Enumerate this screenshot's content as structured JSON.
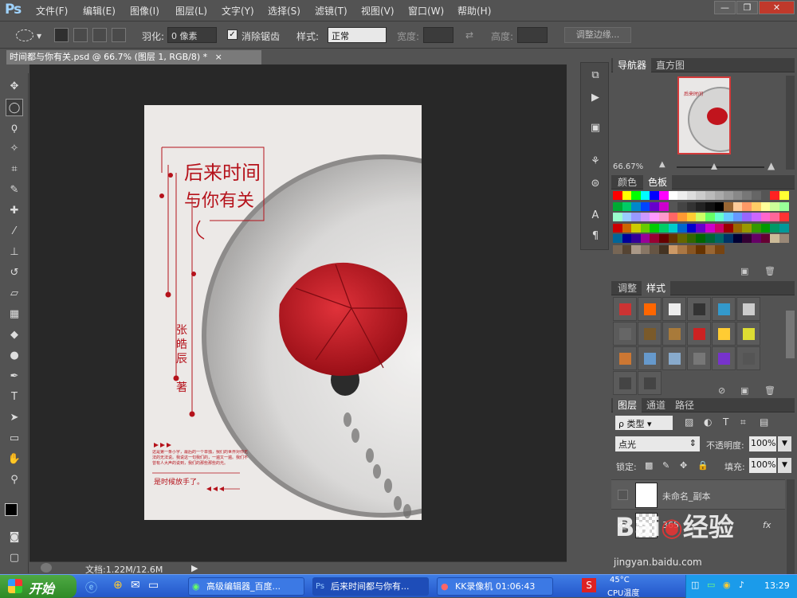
{
  "app": {
    "logo": "Ps"
  },
  "menu": [
    "文件(F)",
    "编辑(E)",
    "图像(I)",
    "图层(L)",
    "文字(Y)",
    "选择(S)",
    "滤镜(T)",
    "视图(V)",
    "窗口(W)",
    "帮助(H)"
  ],
  "window_controls": {
    "minimize": "—",
    "restore": "❐",
    "close": "✕"
  },
  "options": {
    "feather_label": "羽化:",
    "feather_value": "0 像素",
    "antialias_label": "消除锯齿",
    "style_label": "样式:",
    "style_value": "正常",
    "width_label": "宽度:",
    "height_label": "高度:",
    "refine_edge": "调整边缘..."
  },
  "document": {
    "tab_title": "时间都与你有关.psd @ 66.7% (图层 1, RGB/8) *",
    "tab_close": "×"
  },
  "poster": {
    "title_line1": "后来时间",
    "title_line2": "与你有关",
    "author": "张皓辰",
    "author_suffix": "著",
    "body_text": "这是第一条小字，最后的一个单独，我们的世界对你无法的无法说。我说这一句我们的，一遍又一遍。我们不曾有人大声的说到，我们的那些那些的光。",
    "closing_line": "是时候放手了。"
  },
  "status": {
    "doc_size": "文档:1.22M/12.6M"
  },
  "navigator": {
    "tab_active": "导航器",
    "tab_2": "直方图",
    "zoom": "66.67%"
  },
  "color_panel": {
    "tab_1": "颜色",
    "tab_active": "色板"
  },
  "styles_panel": {
    "tab_1": "调整",
    "tab_active": "样式"
  },
  "layers_panel": {
    "tab_active": "图层",
    "tab_2": "通道",
    "tab_3": "路径",
    "filter_kind": "ρ 类型",
    "blend_mode": "点光",
    "opacity_label": "不透明度:",
    "opacity_value": "100%",
    "lock_label": "锁定:",
    "fill_label": "填充:",
    "fill_value": "100%",
    "layers": [
      {
        "name": "未命名_副本"
      },
      {
        "name": "365"
      }
    ],
    "fx": "fx"
  },
  "taskbar": {
    "start": "开始",
    "tasks": [
      "高级编辑器_百度...",
      "后来时间都与你有...",
      "KK录像机 01:06:43"
    ],
    "cpu_temp": "45°C",
    "cpu_label": "CPU温度",
    "time": "13:29"
  },
  "watermark": {
    "site": "jingyan.baidu.com"
  }
}
